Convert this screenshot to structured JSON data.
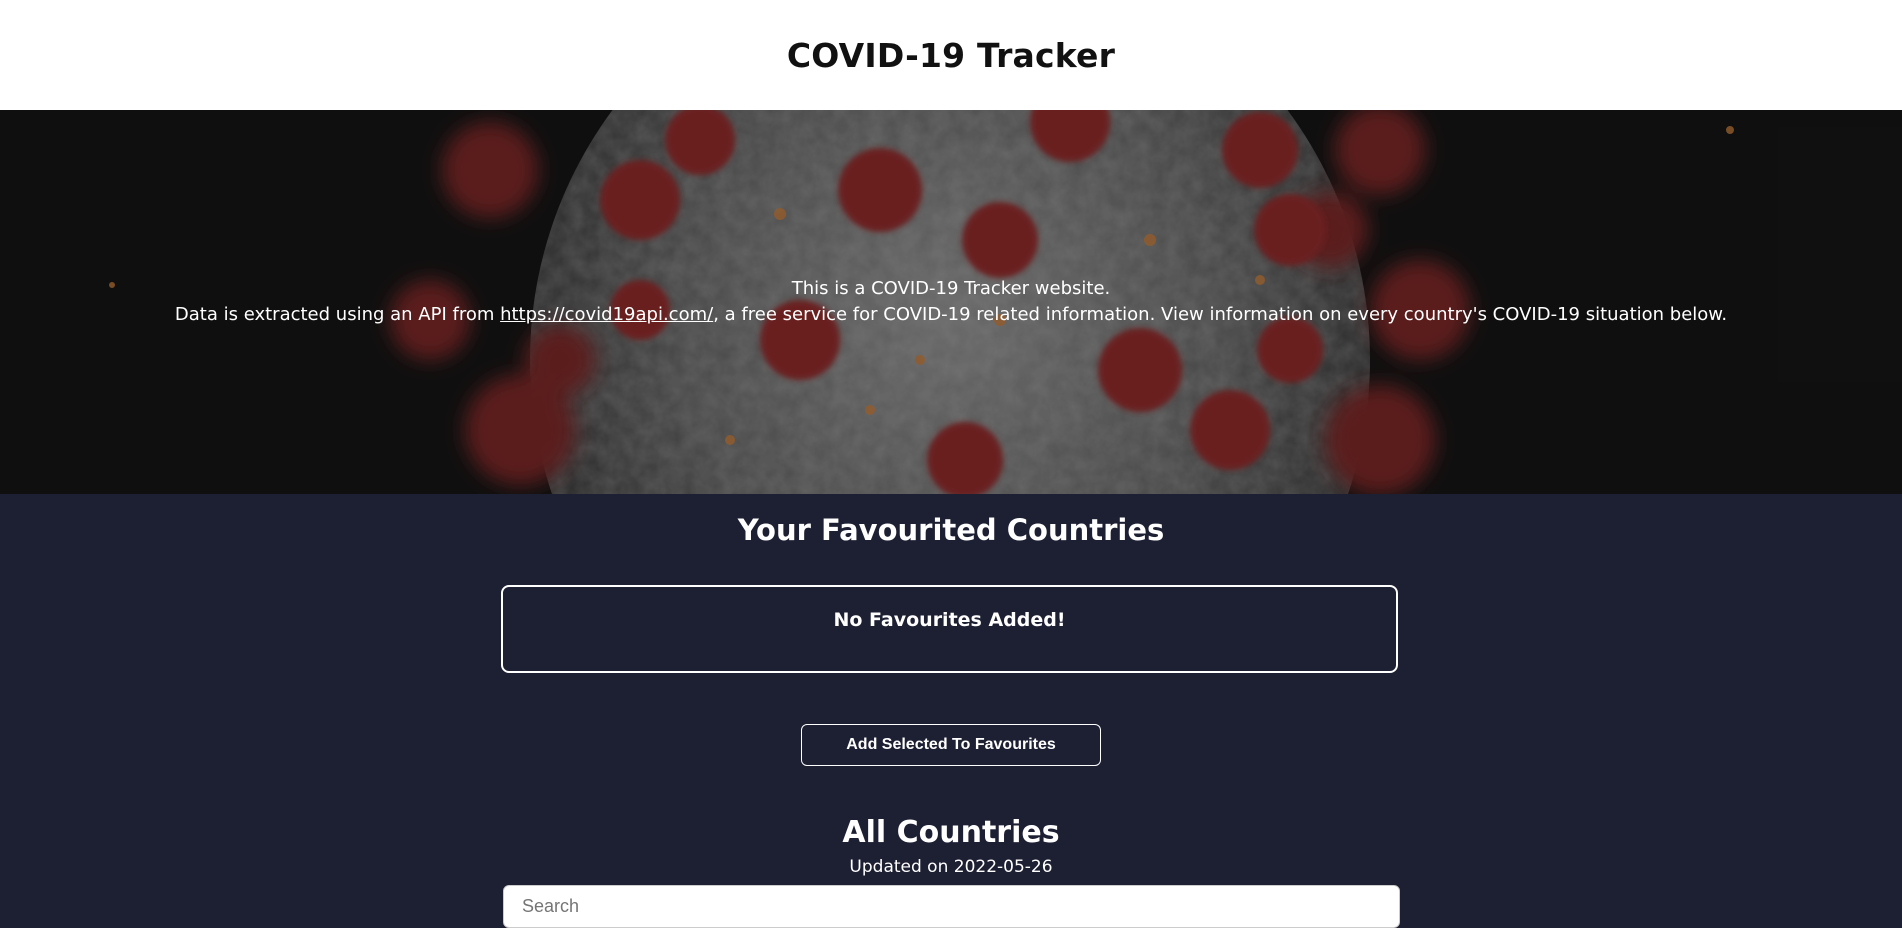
{
  "header": {
    "title": "COVID-19 Tracker"
  },
  "hero": {
    "line1": "This is a COVID-19 Tracker website.",
    "line2_prefix": "Data is extracted using an API from ",
    "link_text": "https://covid19api.com/",
    "line2_suffix": ", a free service for COVID-19 related information. View information on every country's COVID-19 situation below."
  },
  "favourites": {
    "title": "Your Favourited Countries",
    "empty_text": "No Favourites Added!",
    "add_button_label": "Add Selected To Favourites"
  },
  "all_countries": {
    "title": "All Countries",
    "updated_text": "Updated on 2022-05-26",
    "search_placeholder": "Search"
  },
  "colors": {
    "page_background": "#1d1f33",
    "header_background": "#ffffff",
    "spike_red": "#8e2a2a",
    "virus_grey": "#6e6e6e"
  }
}
